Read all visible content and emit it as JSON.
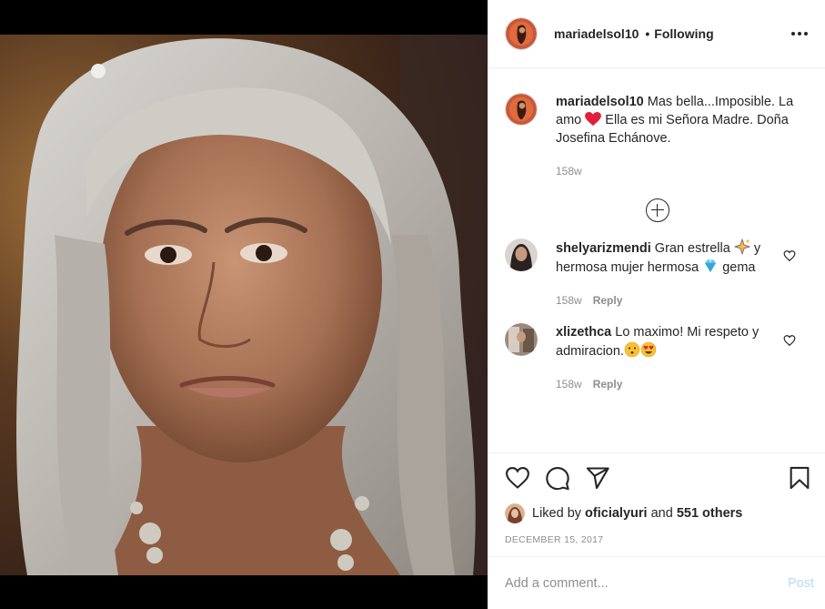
{
  "post": {
    "username": "mariadelsol10",
    "dot": "•",
    "follow_state": "Following",
    "more_icon": "more-horizontal-icon",
    "caption": {
      "username": "mariadelsol10",
      "text_before_heart": " Mas bella...Imposible. La amo ",
      "heart_emoji": "red-heart",
      "text_after_heart": " Ella es mi Señora Madre. Doña Josefina Echánove.",
      "time": "158w"
    },
    "load_more_icon": "plus-circle-icon",
    "comments": [
      {
        "username": "shelyarizmendi",
        "text_1": " Gran estrella ",
        "emoji_1": "sparkles",
        "text_2": " y hermosa mujer hermosa ",
        "emoji_2": "gem",
        "text_3": " gema",
        "time": "158w",
        "reply": "Reply"
      },
      {
        "username": "xlizethca",
        "text_1": " Lo maximo! Mi respeto y admiracion.",
        "emoji_1": "hushed-face",
        "emoji_2": "heart-eyes",
        "time": "158w",
        "reply": "Reply"
      }
    ],
    "likes": {
      "prefix": "Liked by ",
      "user": "oficialyuri",
      "middle": " and ",
      "others": "551 others"
    },
    "date": "DECEMBER 15, 2017",
    "comment_input": {
      "placeholder": "Add a comment...",
      "post_label": "Post"
    }
  },
  "colors": {
    "text": "#262626",
    "muted": "#8e8e8e",
    "post_disabled": "#b3dbff",
    "heart": "#ed4956"
  }
}
